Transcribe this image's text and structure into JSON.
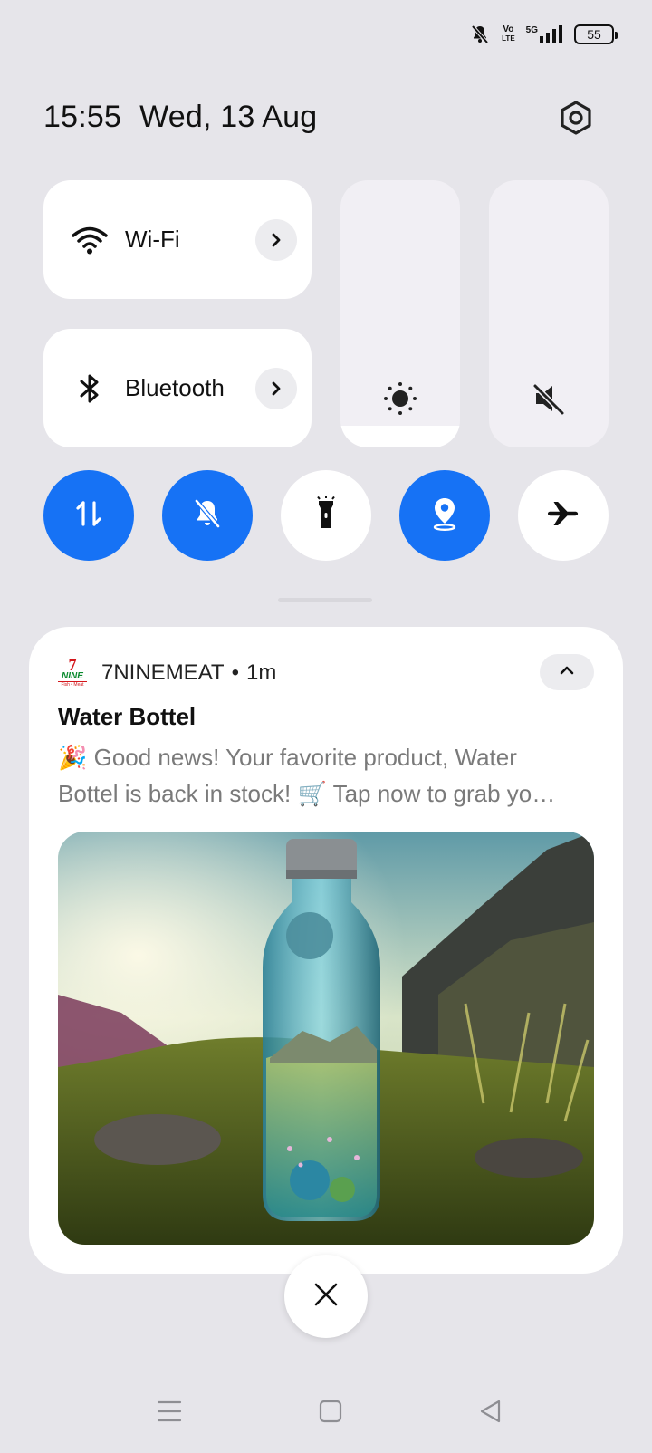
{
  "status_bar": {
    "icons": [
      "bell-muted-icon",
      "volte-icon",
      "5g-signal-icon",
      "battery-icon"
    ],
    "volte_top": "Vo",
    "volte_bottom": "LTE",
    "network": "5G",
    "battery": "55"
  },
  "header": {
    "time": "15:55",
    "date": "Wed, 13 Aug",
    "settings_icon": "gear-icon"
  },
  "quick_settings": {
    "wifi": {
      "label": "Wi-Fi",
      "icon": "wifi-icon"
    },
    "bluetooth": {
      "label": "Bluetooth",
      "icon": "bluetooth-icon"
    },
    "brightness": {
      "icon": "brightness-icon",
      "level": 0.08
    },
    "volume": {
      "icon": "volume-muted-icon"
    },
    "toggles": [
      {
        "name": "mobile-data",
        "icon": "data-transfer-icon",
        "active": true
      },
      {
        "name": "do-not-disturb",
        "icon": "bell-off-icon",
        "active": true
      },
      {
        "name": "flashlight",
        "icon": "flashlight-icon",
        "active": false
      },
      {
        "name": "location",
        "icon": "location-icon",
        "active": true
      },
      {
        "name": "airplane-mode",
        "icon": "airplane-icon",
        "active": false
      }
    ]
  },
  "notification": {
    "app_name": "7NINEMEAT",
    "separator": "•",
    "time_ago": "1m",
    "logo_top": "7",
    "logo_mid": "NINE",
    "logo_bottom": "Fish • Meat",
    "title": "Water Bottel",
    "body_line1": "🎉 Good news! Your favorite product, Water",
    "body_line2": "Bottel is back in stock! 🛒 Tap now to grab yo…",
    "image": "water-bottle-in-mountain-meadow-image"
  },
  "colors": {
    "accent": "#1672f5",
    "background": "#e6e5ea",
    "tile": "#ffffff"
  },
  "navbar": {
    "icons": [
      "menu-icon",
      "home-icon",
      "back-icon"
    ]
  }
}
